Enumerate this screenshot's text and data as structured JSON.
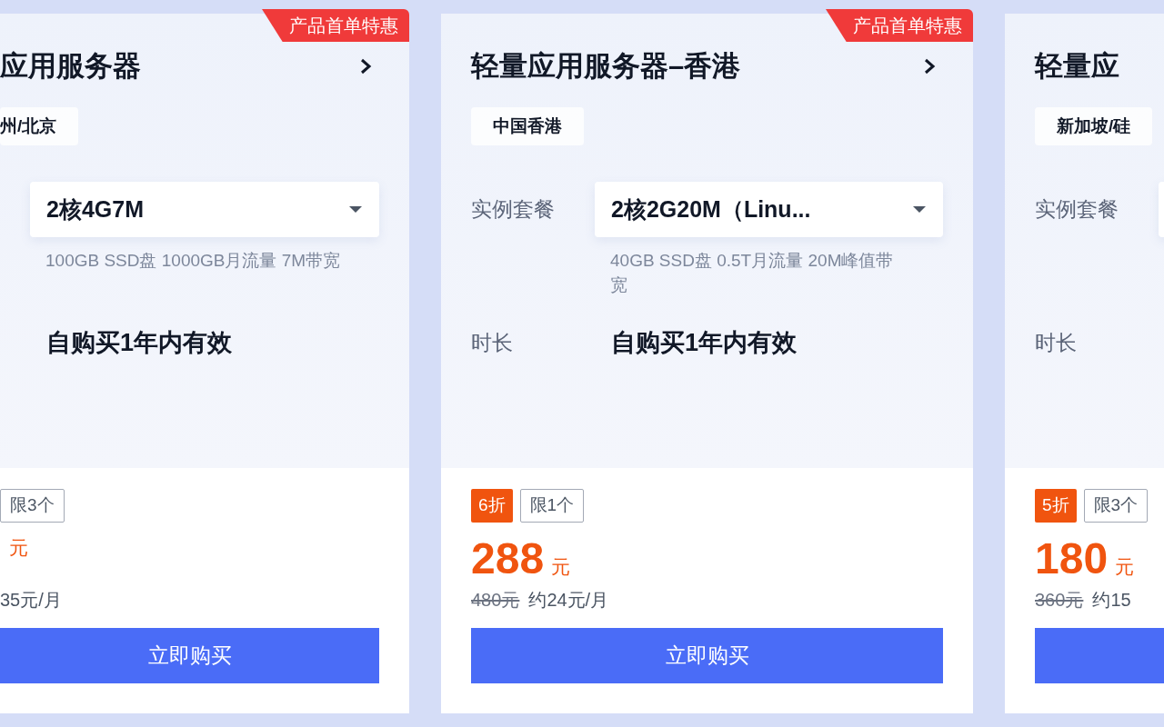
{
  "cards": [
    {
      "kind": "left",
      "promo_tag": "产品首单特惠",
      "title": "应用服务器",
      "region": "州/北京",
      "plan_value": "2核4G7M",
      "plan_spec": "100GB SSD盘 1000GB月流量 7M带宽",
      "duration_value": "自购买1年内有效",
      "limit": "限3个",
      "currency": "元",
      "monthly": "35元/月",
      "buy_button": "立即购买"
    },
    {
      "kind": "full",
      "promo_tag": "产品首单特惠",
      "title": "轻量应用服务器–香港",
      "region": "中国香港",
      "plan_label": "实例套餐",
      "plan_value": "2核2G20M（Linu...",
      "plan_spec": "40GB SSD盘 0.5T月流量 20M峰值带宽",
      "duration_label": "时长",
      "duration_value": "自购买1年内有效",
      "discount": "6折",
      "limit": "限1个",
      "price": "288",
      "currency": "元",
      "original_price": "480元",
      "monthly": "约24元/月",
      "buy_button": "立即购买"
    },
    {
      "kind": "right",
      "title": "轻量应",
      "region": "新加坡/硅",
      "plan_label": "实例套餐",
      "duration_label": "时长",
      "discount": "5折",
      "limit": "限3个",
      "price": "180",
      "currency": "元",
      "original_price": "360元",
      "monthly": "约15"
    }
  ]
}
